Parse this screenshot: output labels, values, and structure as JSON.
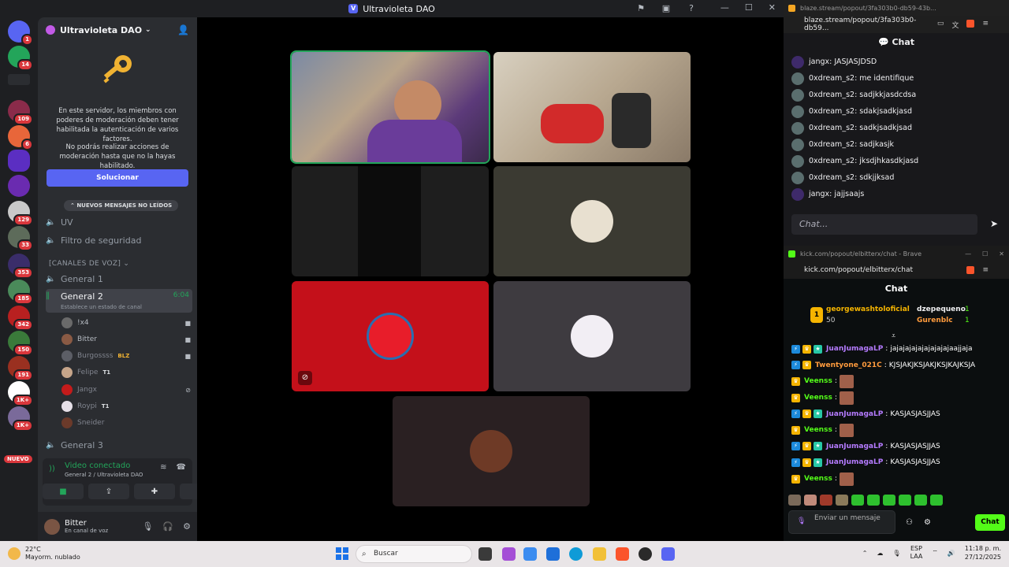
{
  "titlebar": {
    "title": "Ultravioleta DAO"
  },
  "rail": {
    "badges": [
      "1",
      "14",
      "109",
      "6",
      "129",
      "33",
      "353",
      "185",
      "342",
      "150",
      "191",
      "1K+",
      "1K+"
    ],
    "new_label": "NUEVO"
  },
  "sidebar": {
    "server_name": "Ultravioleta DAO",
    "mod_text_1": "En este servidor, los miembros con poderes de moderación deben tener habilitada la autenticación de varios factores.",
    "mod_text_2": "No podrás realizar acciones de moderación hasta que no la hayas habilitado.",
    "fix_button": "Solucionar",
    "unread_pill": "NUEVOS MENSAJES NO LEÍDOS",
    "channels": [
      {
        "name": "UV"
      },
      {
        "name": "Filtro de seguridad"
      }
    ],
    "voice_category": "[CANALES DE VOZ]",
    "voice_channels": {
      "general1": "General 1",
      "general2": "General 2",
      "general2_timer": "6:04",
      "general2_status": "Establece un estado de canal",
      "general3": "General 3"
    },
    "voice_users": [
      {
        "name": "!x4",
        "tag": ""
      },
      {
        "name": "Bitter",
        "tag": ""
      },
      {
        "name": "Burgossss",
        "tag": "BLZ"
      },
      {
        "name": "Felipe",
        "tag": "T1"
      },
      {
        "name": "Jangx",
        "tag": ""
      },
      {
        "name": "Roypi",
        "tag": "T1"
      },
      {
        "name": "Sneider",
        "tag": ""
      }
    ]
  },
  "voice_panel": {
    "title": "Video conectado",
    "subtitle": "General 2 / Ultravioleta DAO"
  },
  "user_panel": {
    "name": "Bitter",
    "status": "En canal de voz"
  },
  "blaze": {
    "tab_title": "blaze.stream/popout/3fa303b0-db59-43b...",
    "url": "blaze.stream/popout/3fa303b0-db59...",
    "chat_title": "Chat",
    "messages": [
      {
        "user": "jangx",
        "text": "JASJASJDSD"
      },
      {
        "user": "0xdream_s2",
        "text": "me identifique"
      },
      {
        "user": "0xdream_s2",
        "text": "sadjkkjasdcdsa"
      },
      {
        "user": "0xdream_s2",
        "text": "sdakjsadkjasd"
      },
      {
        "user": "0xdream_s2",
        "text": "sadkjsadkjsad"
      },
      {
        "user": "0xdream_s2",
        "text": "sadjkasjk"
      },
      {
        "user": "0xdream_s2",
        "text": "jksdjhkasdkjasd"
      },
      {
        "user": "0xdream_s2",
        "text": "sdkjjksad"
      },
      {
        "user": "jangx",
        "text": "jajjsaajs"
      }
    ],
    "input_placeholder": "Chat..."
  },
  "kick": {
    "tab_title": "kick.com/popout/elbitterx/chat - Brave",
    "url": "kick.com/popout/elbitterx/chat",
    "chat_title": "Chat",
    "pinned": {
      "top_user": "georgewashtoloficial",
      "top_amount": "50",
      "second_user": "dzepequeno",
      "second_amount": "1",
      "third_user": "Gurenblc",
      "third_amount": "1",
      "rank": "1"
    },
    "messages": [
      {
        "user": "JuanJumagaLP",
        "text": "jajajajajajajajajajaajjaja",
        "color": "#b57bff",
        "badges": [
          "verified",
          "crown",
          "sub"
        ],
        "emote": false
      },
      {
        "user": "Twentyone_021C",
        "text": "KJSJAKJKSJAKJKSJKAJKSJA",
        "color": "#ff9b3d",
        "badges": [
          "verified",
          "crown"
        ],
        "emote": false
      },
      {
        "user": "Veenss",
        "text": "",
        "color": "#53fc18",
        "badges": [
          "crown"
        ],
        "emote": true
      },
      {
        "user": "Veenss",
        "text": "",
        "color": "#53fc18",
        "badges": [
          "crown"
        ],
        "emote": true
      },
      {
        "user": "JuanJumagaLP",
        "text": "KASJASJASJJAS",
        "color": "#b57bff",
        "badges": [
          "verified",
          "crown",
          "sub"
        ],
        "emote": false
      },
      {
        "user": "Veenss",
        "text": "",
        "color": "#53fc18",
        "badges": [
          "crown"
        ],
        "emote": true
      },
      {
        "user": "JuanJumagaLP",
        "text": "KASJASJASJJAS",
        "color": "#b57bff",
        "badges": [
          "verified",
          "crown",
          "sub"
        ],
        "emote": false
      },
      {
        "user": "JuanJumagaLP",
        "text": "KASJASJASJJAS",
        "color": "#b57bff",
        "badges": [
          "verified",
          "crown",
          "sub"
        ],
        "emote": false
      },
      {
        "user": "Veenss",
        "text": "",
        "color": "#53fc18",
        "badges": [
          "crown"
        ],
        "emote": true
      }
    ],
    "input_placeholder": "Enviar un mensaje",
    "send_label": "Chat"
  },
  "taskbar": {
    "temperature": "22°C",
    "weather": "Mayorm. nublado",
    "search_placeholder": "Buscar",
    "lang_1": "ESP",
    "lang_2": "LAA",
    "time": "11:18 p. m.",
    "date": "27/12/2025"
  },
  "colors": {
    "speaking": "#23a55a",
    "blurple": "#5865f2",
    "kick_green": "#53fc18"
  }
}
